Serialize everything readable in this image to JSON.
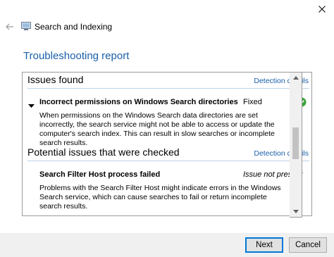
{
  "window": {
    "title": "Search and Indexing",
    "close_icon": "close-icon",
    "back_icon": "back-arrow-icon"
  },
  "report": {
    "title": "Troubleshooting report"
  },
  "issues_found": {
    "heading": "Issues found",
    "details_link": "Detection details",
    "items": [
      {
        "title": "Incorrect permissions on Windows Search directories",
        "status": "Fixed",
        "description": "When permissions on the Windows Search data directories are set incorrectly, the search service might not be able to access or update the computer's search index. This can result in slow searches or incomplete search results."
      }
    ]
  },
  "potential_issues": {
    "heading": "Potential issues that were checked",
    "details_link": "Detection details",
    "items": [
      {
        "title": "Search Filter Host process failed",
        "status": "Issue not present",
        "description": "Problems with the Search Filter Host might indicate errors in the Windows Search service, which can cause searches to fail or return incomplete search results."
      }
    ]
  },
  "footer": {
    "next_label": "Next",
    "cancel_label": "Cancel"
  },
  "colors": {
    "accent": "#1a5fa8",
    "success": "#3aa33a"
  }
}
